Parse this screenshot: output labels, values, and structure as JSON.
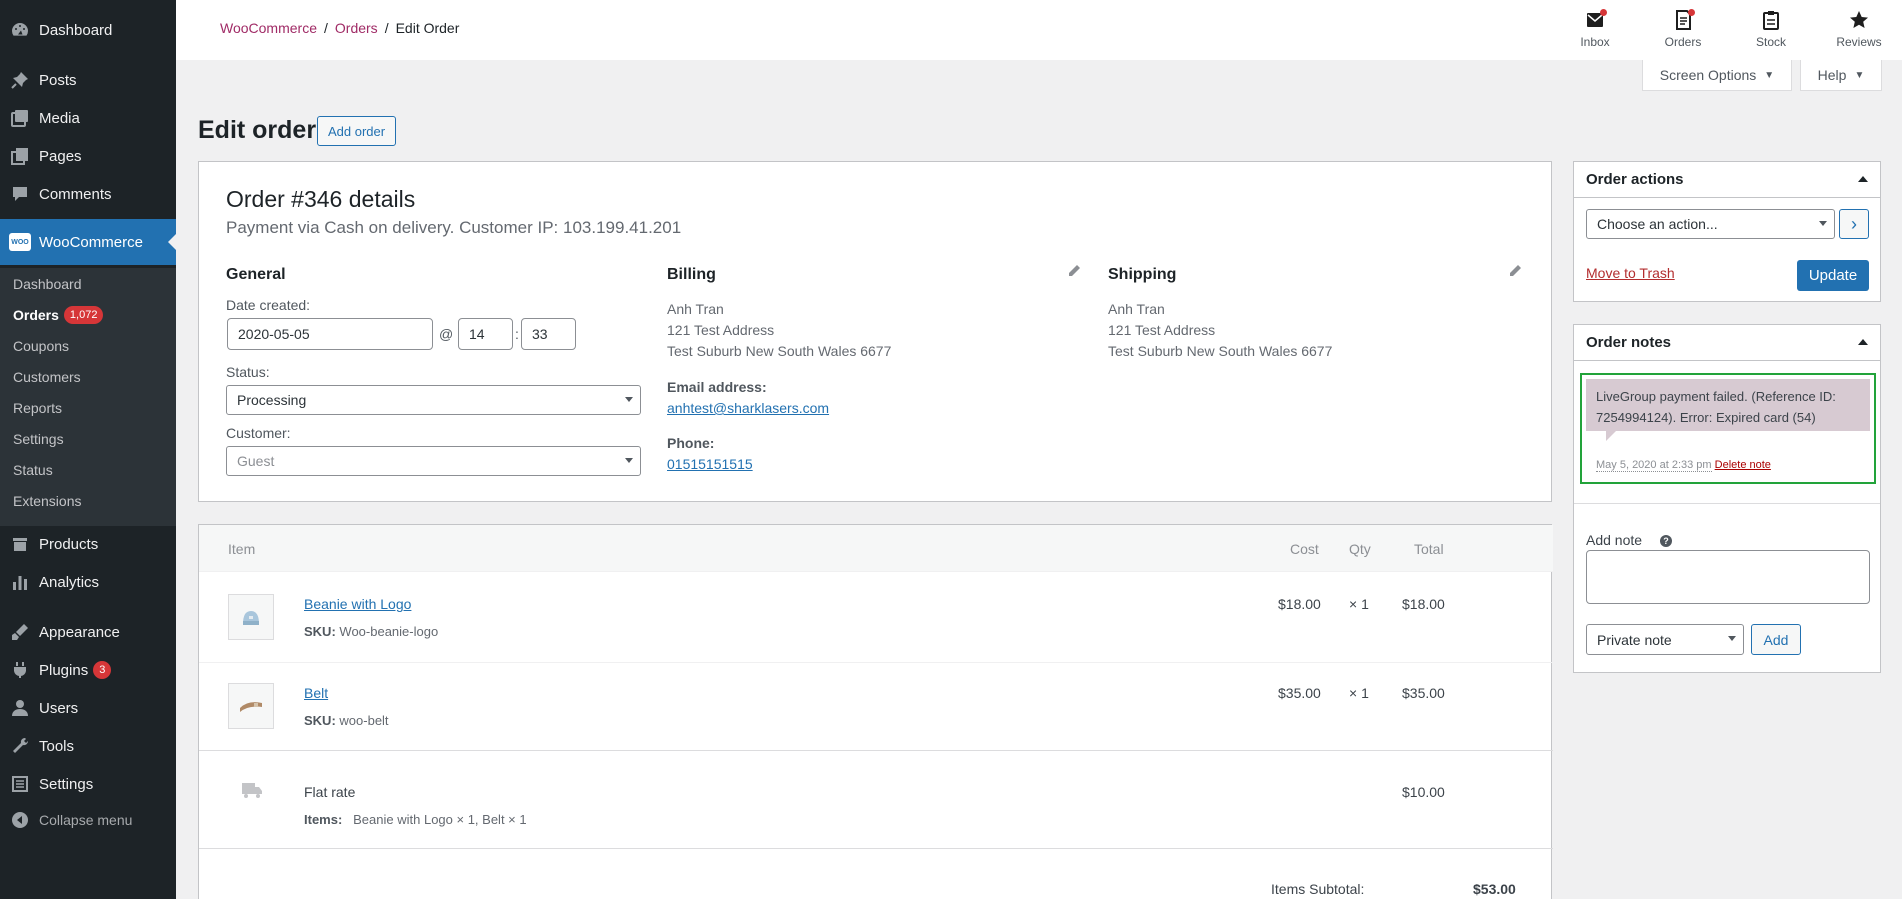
{
  "sidebar": {
    "top_items": [
      {
        "label": "Dashboard",
        "icon": "dashboard-icon"
      },
      {
        "label": "Posts",
        "icon": "pin-icon"
      },
      {
        "label": "Media",
        "icon": "media-icon"
      },
      {
        "label": "Pages",
        "icon": "pages-icon"
      },
      {
        "label": "Comments",
        "icon": "comments-icon"
      }
    ],
    "woocommerce": {
      "label": "WooCommerce",
      "icon_text": "WOO"
    },
    "submenu": [
      {
        "label": "Dashboard"
      },
      {
        "label": "Orders",
        "badge": "1,072"
      },
      {
        "label": "Coupons"
      },
      {
        "label": "Customers"
      },
      {
        "label": "Reports"
      },
      {
        "label": "Settings"
      },
      {
        "label": "Status"
      },
      {
        "label": "Extensions"
      }
    ],
    "bottom_items": [
      {
        "label": "Products",
        "icon": "products-icon"
      },
      {
        "label": "Analytics",
        "icon": "analytics-icon"
      },
      {
        "label": "Appearance",
        "icon": "appearance-icon"
      },
      {
        "label": "Plugins",
        "icon": "plugins-icon",
        "badge": "3"
      },
      {
        "label": "Users",
        "icon": "users-icon"
      },
      {
        "label": "Tools",
        "icon": "tools-icon"
      },
      {
        "label": "Settings",
        "icon": "settings-icon"
      }
    ],
    "collapse_label": "Collapse menu"
  },
  "header": {
    "breadcrumb": [
      "WooCommerce",
      "Orders",
      "Edit Order"
    ],
    "separator": "/",
    "activity": [
      {
        "label": "Inbox",
        "icon": "inbox-icon"
      },
      {
        "label": "Orders",
        "icon": "orders-icon"
      },
      {
        "label": "Stock",
        "icon": "stock-icon"
      },
      {
        "label": "Reviews",
        "icon": "star-icon"
      }
    ],
    "screen_options": "Screen Options",
    "help": "Help"
  },
  "page": {
    "title": "Edit order",
    "add_order": "Add order"
  },
  "order": {
    "title": "Order #346 details",
    "subtitle": "Payment via Cash on delivery. Customer IP: 103.199.41.201",
    "general": {
      "heading": "General",
      "date_label": "Date created:",
      "date": "2020-05-05",
      "at": "@",
      "hour": "14",
      "colon": ":",
      "minute": "33",
      "status_label": "Status:",
      "status": "Processing",
      "customer_label": "Customer:",
      "customer": "Guest"
    },
    "billing": {
      "heading": "Billing",
      "name": "Anh Tran",
      "address1": "121 Test Address",
      "address2": "Test Suburb New South Wales 6677",
      "email_label": "Email address:",
      "email": "anhtest@sharklasers.com",
      "phone_label": "Phone:",
      "phone": "01515151515"
    },
    "shipping": {
      "heading": "Shipping",
      "name": "Anh Tran",
      "address1": "121 Test Address",
      "address2": "Test Suburb New South Wales 6677"
    }
  },
  "items": {
    "headers": {
      "item": "Item",
      "cost": "Cost",
      "qty": "Qty",
      "total": "Total"
    },
    "rows": [
      {
        "name": "Beanie with Logo",
        "sku_label": "SKU:",
        "sku": "Woo-beanie-logo",
        "cost": "$18.00",
        "qty": "× 1",
        "total": "$18.00"
      },
      {
        "name": "Belt",
        "sku_label": "SKU:",
        "sku": "woo-belt",
        "cost": "$35.00",
        "qty": "× 1",
        "total": "$35.00"
      }
    ],
    "shipping": {
      "name": "Flat rate",
      "items_label": "Items:",
      "items": "Beanie with Logo × 1, Belt × 1",
      "total": "$10.00"
    },
    "subtotal_label": "Items Subtotal:",
    "subtotal": "$53.00"
  },
  "order_actions": {
    "title": "Order actions",
    "select": "Choose an action...",
    "go": "›",
    "trash": "Move to Trash",
    "update": "Update"
  },
  "order_notes": {
    "title": "Order notes",
    "note_text": "LiveGroup payment failed. (Reference ID: 7254994124). Error: Expired card (54)",
    "note_date": "May 5, 2020 at 2:33 pm",
    "delete": "Delete note",
    "add_note_label": "Add note",
    "help": "?",
    "note_type": "Private note",
    "add_button": "Add"
  },
  "colors": {
    "primary": "#2271b1",
    "menu_bg": "#1d2327",
    "woo_link": "#a02b66",
    "note_bg": "#d7cad2",
    "highlight": "#22a33a",
    "danger": "#d63638"
  }
}
